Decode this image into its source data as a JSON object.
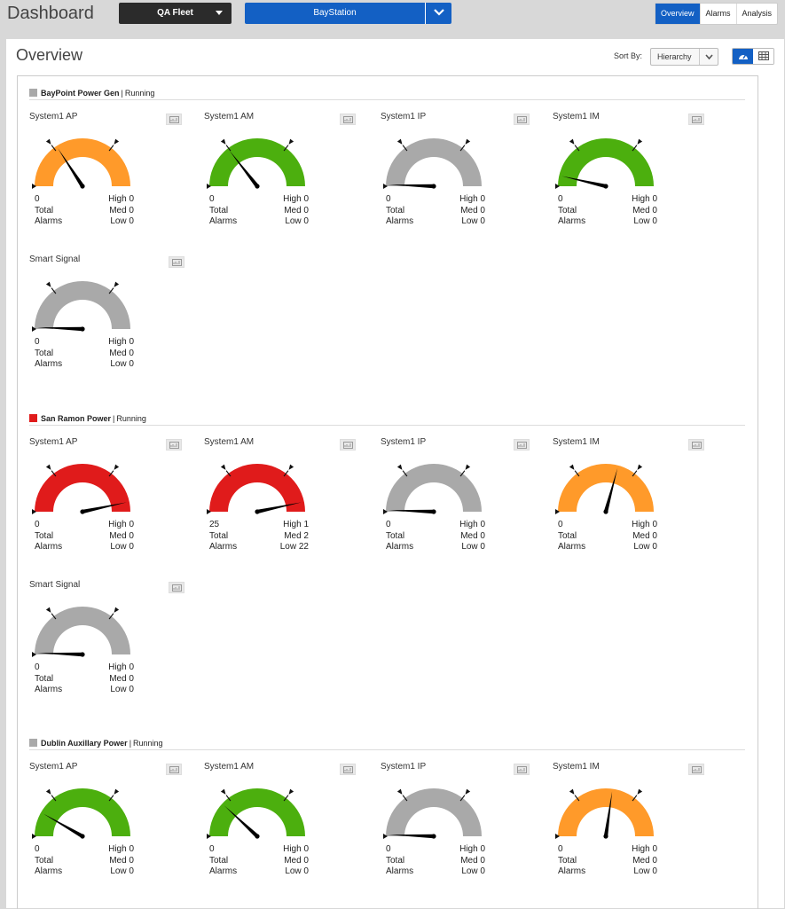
{
  "header": {
    "title": "Dashboard",
    "fleet": "QA Fleet",
    "station": "BayStation",
    "tabs": [
      "Overview",
      "Alarms",
      "Analysis"
    ]
  },
  "main": {
    "title": "Overview",
    "sort_label": "Sort By:",
    "sort_value": "Hierarchy"
  },
  "colors": {
    "orange": "#ff9a2a",
    "green": "#4caf0e",
    "red": "#e01b1b",
    "gray": "#a9a9a9",
    "accent": "#1360c4"
  },
  "groups": [
    {
      "name": "BayPoint Power Gen",
      "status": "Running",
      "status_color": "#a9a9a9",
      "tiles": [
        {
          "name": "System1 AP",
          "color": "orange",
          "needle": 57,
          "total": "0",
          "high": "High 0",
          "med": "Med 0",
          "low": "Low 0"
        },
        {
          "name": "System1 AM",
          "color": "green",
          "needle": 52,
          "total": "0",
          "high": "High 0",
          "med": "Med 0",
          "low": "Low 0"
        },
        {
          "name": "System1 IP",
          "color": "gray",
          "needle": 2,
          "total": "0",
          "high": "High 0",
          "med": "Med 0",
          "low": "Low 0"
        },
        {
          "name": "System1 IM",
          "color": "green",
          "needle": 13,
          "total": "0",
          "high": "High 0",
          "med": "Med 0",
          "low": "Low 0"
        },
        {
          "name": "Smart Signal",
          "color": "gray",
          "needle": 2,
          "total": "0",
          "high": "High 0",
          "med": "Med 0",
          "low": "Low 0"
        }
      ]
    },
    {
      "name": "San Ramon Power",
      "status": "Running",
      "status_color": "#e01b1b",
      "tiles": [
        {
          "name": "System1 AP",
          "color": "red",
          "needle": 168,
          "total": "0",
          "high": "High 0",
          "med": "Med 0",
          "low": "Low 0"
        },
        {
          "name": "System1 AM",
          "color": "red",
          "needle": 168,
          "total": "25",
          "high": "High 1",
          "med": "Med 2",
          "low": "Low 22"
        },
        {
          "name": "System1 IP",
          "color": "gray",
          "needle": 2,
          "total": "0",
          "high": "High 0",
          "med": "Med 0",
          "low": "Low 0"
        },
        {
          "name": "System1 IM",
          "color": "orange",
          "needle": 105,
          "total": "0",
          "high": "High 0",
          "med": "Med 0",
          "low": "Low 0"
        },
        {
          "name": "Smart Signal",
          "color": "gray",
          "needle": 2,
          "total": "0",
          "high": "High 0",
          "med": "Med 0",
          "low": "Low 0"
        }
      ]
    },
    {
      "name": "Dublin Auxillary Power",
      "status": "Running",
      "status_color": "#a9a9a9",
      "tiles": [
        {
          "name": "System1 AP",
          "color": "green",
          "needle": 30,
          "total": "0",
          "high": "High 0",
          "med": "Med 0",
          "low": "Low 0"
        },
        {
          "name": "System1 AM",
          "color": "green",
          "needle": 43,
          "total": "0",
          "high": "High 0",
          "med": "Med 0",
          "low": "Low 0"
        },
        {
          "name": "System1 IP",
          "color": "gray",
          "needle": 2,
          "total": "0",
          "high": "High 0",
          "med": "Med 0",
          "low": "Low 0"
        },
        {
          "name": "System1 IM",
          "color": "orange",
          "needle": 98,
          "total": "0",
          "high": "High 0",
          "med": "Med 0",
          "low": "Low 0"
        }
      ]
    }
  ],
  "stat_labels": {
    "total": "Total",
    "alarms": "Alarms"
  }
}
